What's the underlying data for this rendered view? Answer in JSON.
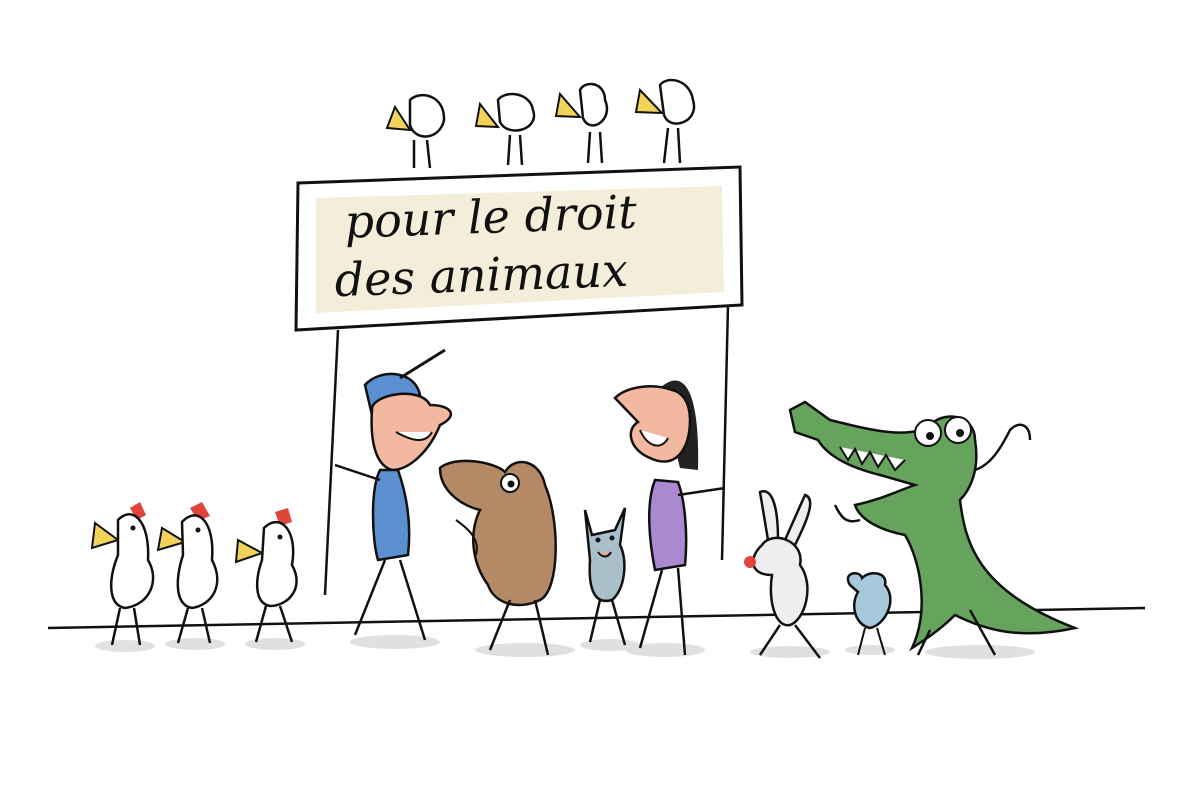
{
  "banner": {
    "line1": "pour le droit",
    "line2": "des animaux"
  },
  "colors": {
    "banner_fill": "#f3edd9",
    "ink": "#111111",
    "man_shirt": "#5b8fd0",
    "woman_dress": "#a98ad0",
    "skin": "#f3b9a0",
    "dog": "#b48966",
    "cat": "#a9bfc9",
    "crocodile": "#66a35d",
    "rabbit": "#eeeeee",
    "mouse": "#a7c8dc",
    "comb": "#e0443a",
    "beak": "#f2d35a",
    "shadow": "#d6d6d6"
  }
}
